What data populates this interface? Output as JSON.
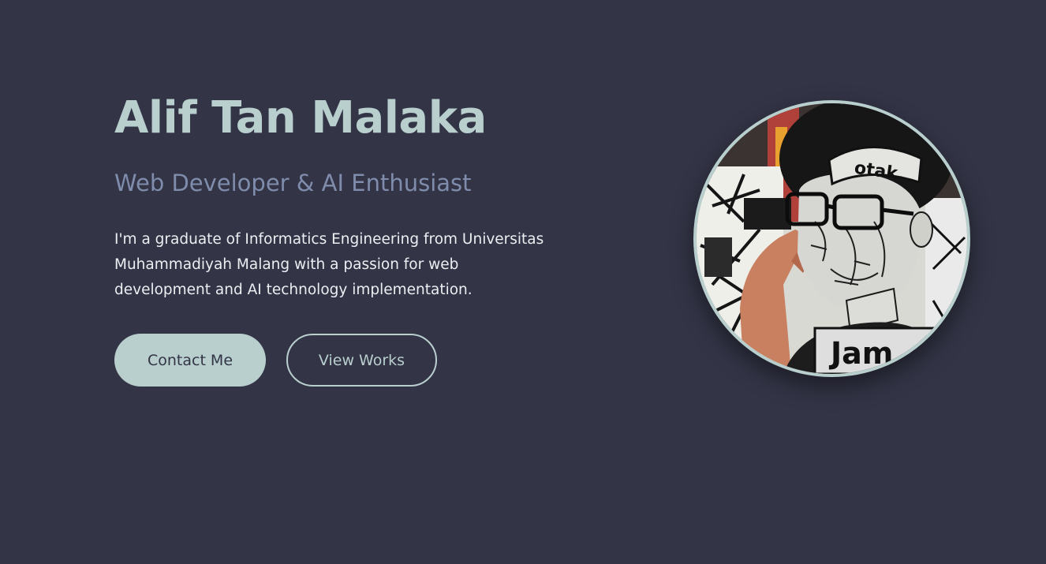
{
  "hero": {
    "name": "Alif Tan Malaka",
    "tagline": "Web Developer & AI Enthusiast",
    "bio": "I'm a graduate of Informatics Engineering from Universitas Muhammadiyah Malang with a passion for web development and AI technology implementation.",
    "buttons": {
      "contact_label": "Contact Me",
      "works_label": "View Works"
    },
    "portrait": {
      "alt": "Alif Tan Malaka",
      "headband_text": "otak",
      "shirt_text": "Jam"
    }
  },
  "colors": {
    "background": "#333446",
    "accent": "#b8cfce",
    "tagline": "#7f8cac",
    "text": "#eaeff2"
  }
}
